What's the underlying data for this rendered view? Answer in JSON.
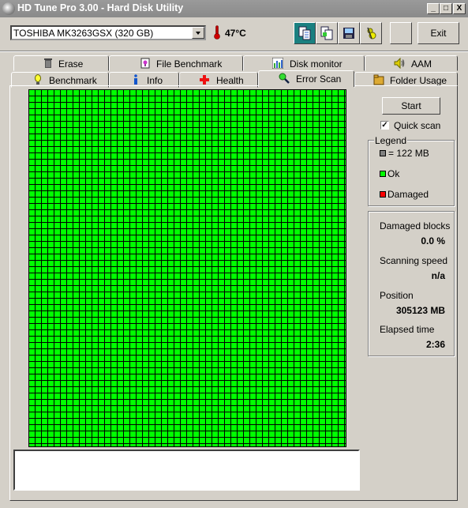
{
  "window": {
    "title": "HD Tune Pro 3.00 - Hard Disk Utility",
    "minimize_label": "_",
    "maximize_label": "□",
    "close_label": "X"
  },
  "toolbar": {
    "drive_selected": "TOSHIBA MK3263GSX (320 GB)",
    "temperature": "47°C",
    "buttons": [
      {
        "icon": "copy-info-icon",
        "active": true
      },
      {
        "icon": "copy-screenshot-icon",
        "active": false
      },
      {
        "icon": "save-icon",
        "active": false
      },
      {
        "icon": "options-icon",
        "active": false
      },
      {
        "icon": "",
        "active": false
      }
    ],
    "exit_label": "Exit"
  },
  "tabs": {
    "row_top": [
      {
        "label": "Erase",
        "icon": "trash-icon"
      },
      {
        "label": "File Benchmark",
        "icon": "file-benchmark-icon"
      },
      {
        "label": "Disk monitor",
        "icon": "disk-monitor-icon"
      },
      {
        "label": "AAM",
        "icon": "speaker-icon"
      }
    ],
    "row_bottom": [
      {
        "label": "Benchmark",
        "icon": "lightbulb-icon"
      },
      {
        "label": "Info",
        "icon": "info-icon"
      },
      {
        "label": "Health",
        "icon": "health-cross-icon"
      },
      {
        "label": "Error Scan",
        "icon": "magnifier-icon",
        "selected": true
      },
      {
        "label": "Folder Usage",
        "icon": "folder-icon"
      }
    ]
  },
  "error_scan": {
    "grid": {
      "columns": 50,
      "rows": 56,
      "status": "all-ok",
      "ok_color": "#00ff00",
      "damaged_color": "#ff0000",
      "unscanned_color": "#808080"
    },
    "start_label": "Start",
    "quick_scan_label": "Quick scan",
    "quick_scan_checked": true,
    "legend": {
      "title": "Legend",
      "items": [
        {
          "label": "= 122 MB",
          "color": "#808080"
        },
        {
          "label": "Ok",
          "color": "#00ff00"
        },
        {
          "label": "Damaged",
          "color": "#ff0000"
        }
      ]
    },
    "stats": {
      "damaged_blocks_label": "Damaged blocks",
      "damaged_blocks_value": "0.0 %",
      "scanning_speed_label": "Scanning speed",
      "scanning_speed_value": "n/a",
      "position_label": "Position",
      "position_value": "305123 MB",
      "elapsed_label": "Elapsed time",
      "elapsed_value": "2:36"
    },
    "log_text": ""
  }
}
